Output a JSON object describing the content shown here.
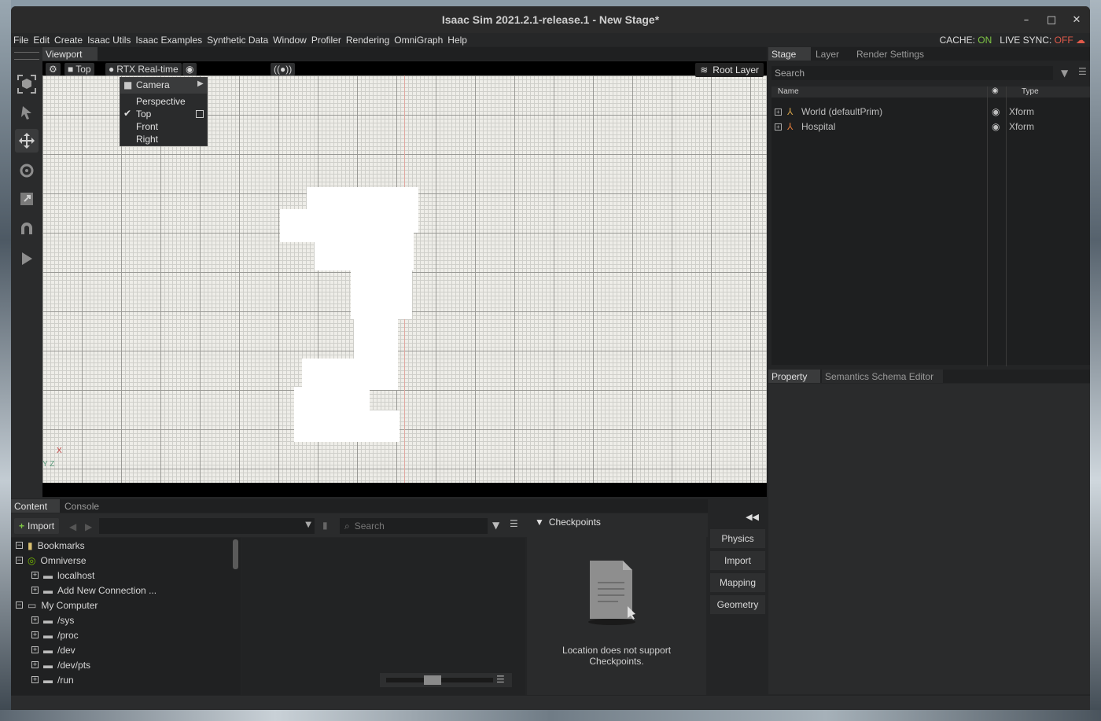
{
  "window": {
    "title": "Isaac Sim 2021.2.1-release.1 - New Stage*",
    "controls": {
      "minimize": "–",
      "maximize": "□",
      "close": "✕"
    }
  },
  "menubar": {
    "items": [
      "File",
      "Edit",
      "Create",
      "Isaac Utils",
      "Isaac Examples",
      "Synthetic Data",
      "Window",
      "Profiler",
      "Rendering",
      "OmniGraph",
      "Help"
    ],
    "cache_label": "CACHE:",
    "cache_value": "ON",
    "live_sync_label": "LIVE SYNC:",
    "live_sync_value": "OFF"
  },
  "viewport": {
    "tab": "Viewport",
    "camera_button": "Top",
    "render_mode_button": "RTX Real-time",
    "root_layer": "Root Layer",
    "axis_x": "X",
    "axis_yz": "Y Z"
  },
  "camera_menu": {
    "header": "Camera",
    "items": [
      "Perspective",
      "Top",
      "Front",
      "Right"
    ],
    "checked": "Top"
  },
  "right_tabs": [
    "Stage",
    "Layer",
    "Render Settings"
  ],
  "stage": {
    "search_placeholder": "Search",
    "columns": {
      "name": "Name",
      "type": "Type"
    },
    "rows": [
      {
        "name": "World (defaultPrim)",
        "type": "Xform"
      },
      {
        "name": "Hospital",
        "type": "Xform"
      }
    ]
  },
  "property_tabs": [
    "Property",
    "Semantics Schema Editor"
  ],
  "content_tabs": [
    "Content",
    "Console"
  ],
  "content": {
    "import_label": "Import",
    "search_placeholder": "Search",
    "tree": [
      {
        "label": "Bookmarks",
        "level": 0,
        "expander": "−"
      },
      {
        "label": "Omniverse",
        "level": 0,
        "expander": "−"
      },
      {
        "label": "localhost",
        "level": 1,
        "expander": "+"
      },
      {
        "label": "Add New Connection ...",
        "level": 1,
        "expander": "+"
      },
      {
        "label": "My Computer",
        "level": 0,
        "expander": "−"
      },
      {
        "label": "/sys",
        "level": 1,
        "expander": "+"
      },
      {
        "label": "/proc",
        "level": 1,
        "expander": "+"
      },
      {
        "label": "/dev",
        "level": 1,
        "expander": "+"
      },
      {
        "label": "/dev/pts",
        "level": 1,
        "expander": "+"
      },
      {
        "label": "/run",
        "level": 1,
        "expander": "+"
      }
    ],
    "checkpoints_title": "Checkpoints",
    "checkpoints_message": "Location does not support Checkpoints."
  },
  "side_buttons": [
    "Physics",
    "Import",
    "Mapping",
    "Geometry"
  ]
}
